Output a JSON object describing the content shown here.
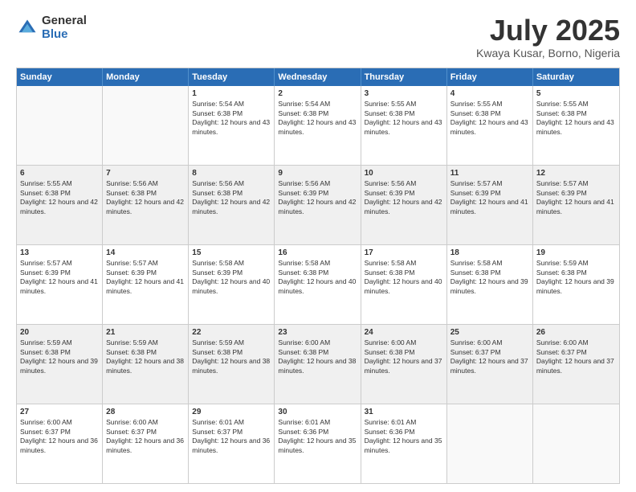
{
  "logo": {
    "general": "General",
    "blue": "Blue"
  },
  "title": "July 2025",
  "location": "Kwaya Kusar, Borno, Nigeria",
  "weekdays": [
    "Sunday",
    "Monday",
    "Tuesday",
    "Wednesday",
    "Thursday",
    "Friday",
    "Saturday"
  ],
  "weeks": [
    [
      {
        "day": "",
        "sunrise": "",
        "sunset": "",
        "daylight": "",
        "empty": true
      },
      {
        "day": "",
        "sunrise": "",
        "sunset": "",
        "daylight": "",
        "empty": true
      },
      {
        "day": "1",
        "sunrise": "Sunrise: 5:54 AM",
        "sunset": "Sunset: 6:38 PM",
        "daylight": "Daylight: 12 hours and 43 minutes."
      },
      {
        "day": "2",
        "sunrise": "Sunrise: 5:54 AM",
        "sunset": "Sunset: 6:38 PM",
        "daylight": "Daylight: 12 hours and 43 minutes."
      },
      {
        "day": "3",
        "sunrise": "Sunrise: 5:55 AM",
        "sunset": "Sunset: 6:38 PM",
        "daylight": "Daylight: 12 hours and 43 minutes."
      },
      {
        "day": "4",
        "sunrise": "Sunrise: 5:55 AM",
        "sunset": "Sunset: 6:38 PM",
        "daylight": "Daylight: 12 hours and 43 minutes."
      },
      {
        "day": "5",
        "sunrise": "Sunrise: 5:55 AM",
        "sunset": "Sunset: 6:38 PM",
        "daylight": "Daylight: 12 hours and 43 minutes."
      }
    ],
    [
      {
        "day": "6",
        "sunrise": "Sunrise: 5:55 AM",
        "sunset": "Sunset: 6:38 PM",
        "daylight": "Daylight: 12 hours and 42 minutes."
      },
      {
        "day": "7",
        "sunrise": "Sunrise: 5:56 AM",
        "sunset": "Sunset: 6:38 PM",
        "daylight": "Daylight: 12 hours and 42 minutes."
      },
      {
        "day": "8",
        "sunrise": "Sunrise: 5:56 AM",
        "sunset": "Sunset: 6:38 PM",
        "daylight": "Daylight: 12 hours and 42 minutes."
      },
      {
        "day": "9",
        "sunrise": "Sunrise: 5:56 AM",
        "sunset": "Sunset: 6:39 PM",
        "daylight": "Daylight: 12 hours and 42 minutes."
      },
      {
        "day": "10",
        "sunrise": "Sunrise: 5:56 AM",
        "sunset": "Sunset: 6:39 PM",
        "daylight": "Daylight: 12 hours and 42 minutes."
      },
      {
        "day": "11",
        "sunrise": "Sunrise: 5:57 AM",
        "sunset": "Sunset: 6:39 PM",
        "daylight": "Daylight: 12 hours and 41 minutes."
      },
      {
        "day": "12",
        "sunrise": "Sunrise: 5:57 AM",
        "sunset": "Sunset: 6:39 PM",
        "daylight": "Daylight: 12 hours and 41 minutes."
      }
    ],
    [
      {
        "day": "13",
        "sunrise": "Sunrise: 5:57 AM",
        "sunset": "Sunset: 6:39 PM",
        "daylight": "Daylight: 12 hours and 41 minutes."
      },
      {
        "day": "14",
        "sunrise": "Sunrise: 5:57 AM",
        "sunset": "Sunset: 6:39 PM",
        "daylight": "Daylight: 12 hours and 41 minutes."
      },
      {
        "day": "15",
        "sunrise": "Sunrise: 5:58 AM",
        "sunset": "Sunset: 6:39 PM",
        "daylight": "Daylight: 12 hours and 40 minutes."
      },
      {
        "day": "16",
        "sunrise": "Sunrise: 5:58 AM",
        "sunset": "Sunset: 6:38 PM",
        "daylight": "Daylight: 12 hours and 40 minutes."
      },
      {
        "day": "17",
        "sunrise": "Sunrise: 5:58 AM",
        "sunset": "Sunset: 6:38 PM",
        "daylight": "Daylight: 12 hours and 40 minutes."
      },
      {
        "day": "18",
        "sunrise": "Sunrise: 5:58 AM",
        "sunset": "Sunset: 6:38 PM",
        "daylight": "Daylight: 12 hours and 39 minutes."
      },
      {
        "day": "19",
        "sunrise": "Sunrise: 5:59 AM",
        "sunset": "Sunset: 6:38 PM",
        "daylight": "Daylight: 12 hours and 39 minutes."
      }
    ],
    [
      {
        "day": "20",
        "sunrise": "Sunrise: 5:59 AM",
        "sunset": "Sunset: 6:38 PM",
        "daylight": "Daylight: 12 hours and 39 minutes."
      },
      {
        "day": "21",
        "sunrise": "Sunrise: 5:59 AM",
        "sunset": "Sunset: 6:38 PM",
        "daylight": "Daylight: 12 hours and 38 minutes."
      },
      {
        "day": "22",
        "sunrise": "Sunrise: 5:59 AM",
        "sunset": "Sunset: 6:38 PM",
        "daylight": "Daylight: 12 hours and 38 minutes."
      },
      {
        "day": "23",
        "sunrise": "Sunrise: 6:00 AM",
        "sunset": "Sunset: 6:38 PM",
        "daylight": "Daylight: 12 hours and 38 minutes."
      },
      {
        "day": "24",
        "sunrise": "Sunrise: 6:00 AM",
        "sunset": "Sunset: 6:38 PM",
        "daylight": "Daylight: 12 hours and 37 minutes."
      },
      {
        "day": "25",
        "sunrise": "Sunrise: 6:00 AM",
        "sunset": "Sunset: 6:37 PM",
        "daylight": "Daylight: 12 hours and 37 minutes."
      },
      {
        "day": "26",
        "sunrise": "Sunrise: 6:00 AM",
        "sunset": "Sunset: 6:37 PM",
        "daylight": "Daylight: 12 hours and 37 minutes."
      }
    ],
    [
      {
        "day": "27",
        "sunrise": "Sunrise: 6:00 AM",
        "sunset": "Sunset: 6:37 PM",
        "daylight": "Daylight: 12 hours and 36 minutes."
      },
      {
        "day": "28",
        "sunrise": "Sunrise: 6:00 AM",
        "sunset": "Sunset: 6:37 PM",
        "daylight": "Daylight: 12 hours and 36 minutes."
      },
      {
        "day": "29",
        "sunrise": "Sunrise: 6:01 AM",
        "sunset": "Sunset: 6:37 PM",
        "daylight": "Daylight: 12 hours and 36 minutes."
      },
      {
        "day": "30",
        "sunrise": "Sunrise: 6:01 AM",
        "sunset": "Sunset: 6:36 PM",
        "daylight": "Daylight: 12 hours and 35 minutes."
      },
      {
        "day": "31",
        "sunrise": "Sunrise: 6:01 AM",
        "sunset": "Sunset: 6:36 PM",
        "daylight": "Daylight: 12 hours and 35 minutes."
      },
      {
        "day": "",
        "sunrise": "",
        "sunset": "",
        "daylight": "",
        "empty": true
      },
      {
        "day": "",
        "sunrise": "",
        "sunset": "",
        "daylight": "",
        "empty": true
      }
    ]
  ]
}
